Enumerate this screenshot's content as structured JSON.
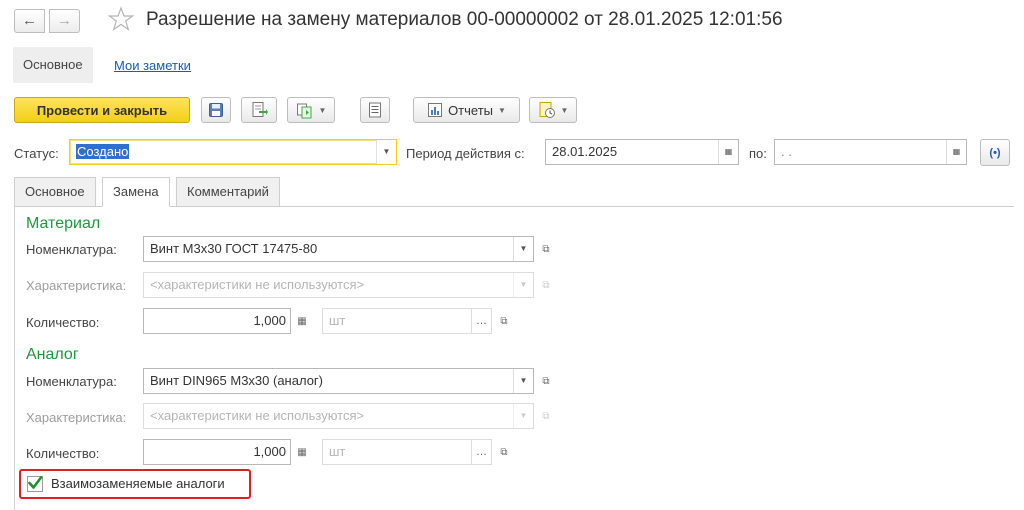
{
  "title": "Разрешение на замену материалов 00-00000002 от 28.01.2025 12:01:56",
  "nav": {
    "back_glyph": "←",
    "forward_glyph": "→"
  },
  "section_tabs": {
    "main": "Основное",
    "notes": "Мои заметки"
  },
  "toolbar": {
    "post_close": "Провести и закрыть",
    "reports": "Отчеты"
  },
  "header": {
    "status_label": "Статус:",
    "status_value": "Создано",
    "period_label": "Период действия с:",
    "period_from": "28.01.2025",
    "period_to_label": "по:",
    "period_to": " .  ."
  },
  "inner_tabs": [
    "Основное",
    "Замена",
    "Комментарий"
  ],
  "material": {
    "title": "Материал",
    "nomenclature_label": "Номенклатура:",
    "nomenclature_value": "Винт М3х30 ГОСТ 17475-80",
    "characteristic_label": "Характеристика:",
    "characteristic_placeholder": "<характеристики не используются>",
    "quantity_label": "Количество:",
    "quantity_value": "1,000",
    "unit_placeholder": "шт"
  },
  "analog": {
    "title": "Аналог",
    "nomenclature_label": "Номенклатура:",
    "nomenclature_value": "Винт DIN965 М3х30 (аналог)",
    "characteristic_label": "Характеристика:",
    "characteristic_placeholder": "<характеристики не используются>",
    "quantity_label": "Количество:",
    "quantity_value": "1,000",
    "unit_placeholder": "шт"
  },
  "interchangeable": {
    "label": "Взаимозаменяемые аналоги",
    "checked": true
  },
  "colors": {
    "accent_yellow": "#f3cf17",
    "group_green": "#1a9a3a",
    "link_blue": "#1a59b8",
    "highlight_red": "#e02020"
  }
}
